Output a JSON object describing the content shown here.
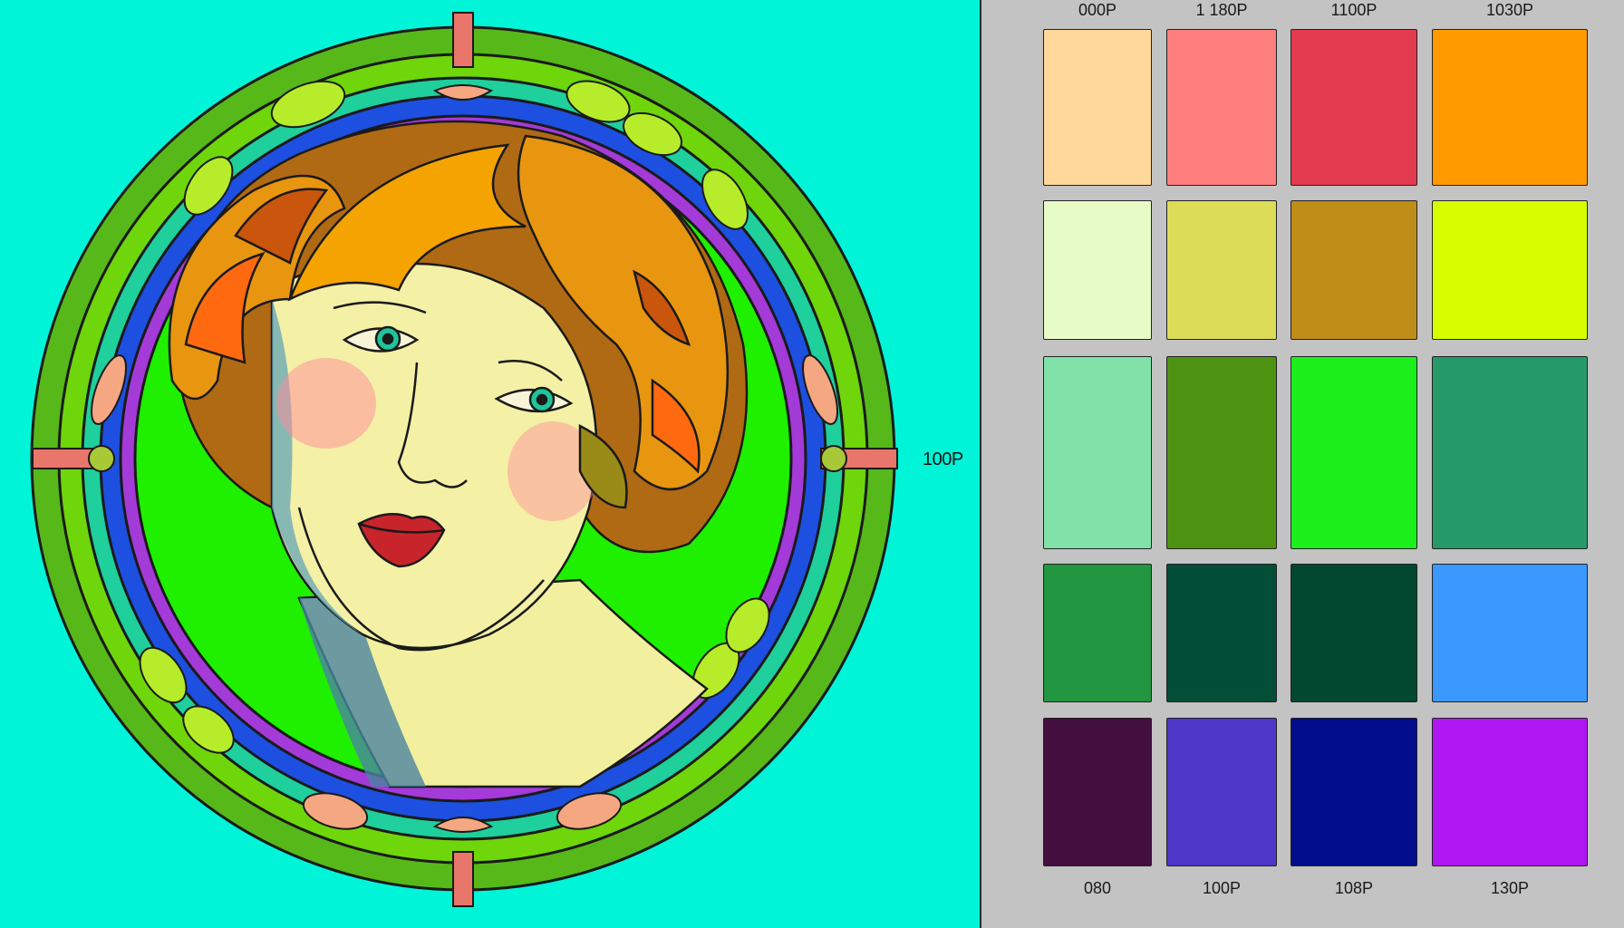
{
  "canvas": {
    "background": "#00f5d8",
    "side_label": "100P"
  },
  "palette": {
    "top_labels": [
      "000P",
      "1 180P",
      "1100P",
      "1030P"
    ],
    "bottom_labels": [
      "080",
      "100P",
      "108P",
      "130P"
    ],
    "rows": [
      [
        "#ffd89a",
        "#ff7e7e",
        "#e23a4e",
        "#ff9a00"
      ],
      [
        "#e8fcc8",
        "#dcdc58",
        "#bf8e18",
        "#d8ff00"
      ],
      [
        "#80e2a8",
        "#4e9212",
        "#1cf01c",
        "#259a68"
      ],
      [
        "#229640",
        "#024e36",
        "#024830",
        "#3a98ff"
      ],
      [
        "#430f3e",
        "#4e36c8",
        "#020d8e",
        "#b016f2"
      ]
    ]
  }
}
